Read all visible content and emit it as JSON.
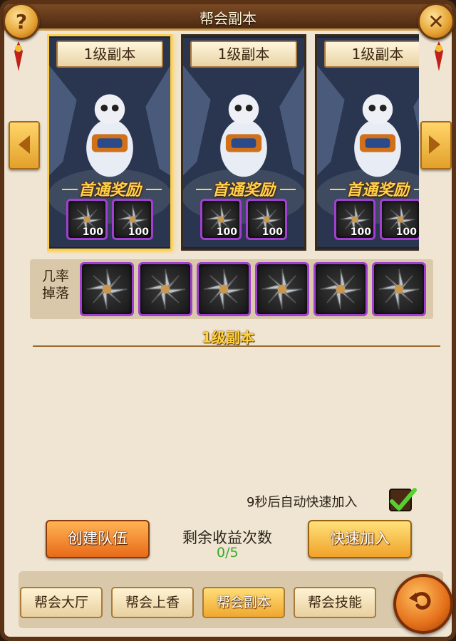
{
  "window": {
    "title": "帮会副本"
  },
  "header": {
    "help_icon_text": "?",
    "close_icon_text": "✕"
  },
  "cards": [
    {
      "label": "1级副本",
      "reward_title": "首通奖励",
      "rewards": [
        {
          "qty": "100"
        },
        {
          "qty": "100"
        }
      ],
      "selected": true
    },
    {
      "label": "1级副本",
      "reward_title": "首通奖励",
      "rewards": [
        {
          "qty": "100"
        },
        {
          "qty": "100"
        }
      ],
      "selected": false
    },
    {
      "label": "1级副本",
      "reward_title": "首通奖励",
      "rewards": [
        {
          "qty": "100"
        },
        {
          "qty": "100"
        }
      ],
      "selected": false
    }
  ],
  "drops": {
    "label_line1": "几率",
    "label_line2": "掉落",
    "item_count": 6
  },
  "section": {
    "title": "1级副本"
  },
  "auto_join": {
    "text": "9秒后自动快速加入",
    "checked": true
  },
  "actions": {
    "create_team": "创建队伍",
    "quick_join": "快速加入",
    "remaining_label": "剩余收益次数",
    "remaining_value": "0/5"
  },
  "tabs": [
    {
      "label": "帮会大厅",
      "active": false
    },
    {
      "label": "帮会上香",
      "active": false
    },
    {
      "label": "帮会副本",
      "active": true
    },
    {
      "label": "帮会技能",
      "active": false
    }
  ],
  "icons": {
    "help": "question-icon",
    "close": "close-icon",
    "left": "arrow-left-icon",
    "right": "arrow-right-icon",
    "item": "shuriken-icon",
    "check": "checkmark-icon",
    "back": "return-icon"
  }
}
